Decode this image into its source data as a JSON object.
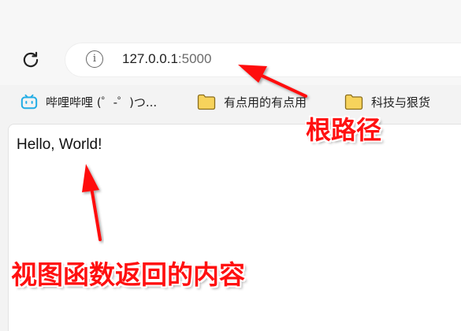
{
  "browser": {
    "url_host": "127.0.0.1",
    "url_port": ":5000",
    "bookmarks": [
      {
        "label": "哔哩哔哩 (゜-゜)つ...",
        "icon": "bilibili-icon"
      },
      {
        "label": "有点用的有点用",
        "icon": "folder-icon"
      },
      {
        "label": "科技与狠货",
        "icon": "folder-icon"
      }
    ]
  },
  "page": {
    "body_text": "Hello, World!"
  },
  "annotations": {
    "url_note": "根路径",
    "content_note": "视图函数返回的内容"
  },
  "colors": {
    "annotation": "#ff1010",
    "bilibili": "#23ade5",
    "folder": "#f1c232"
  }
}
